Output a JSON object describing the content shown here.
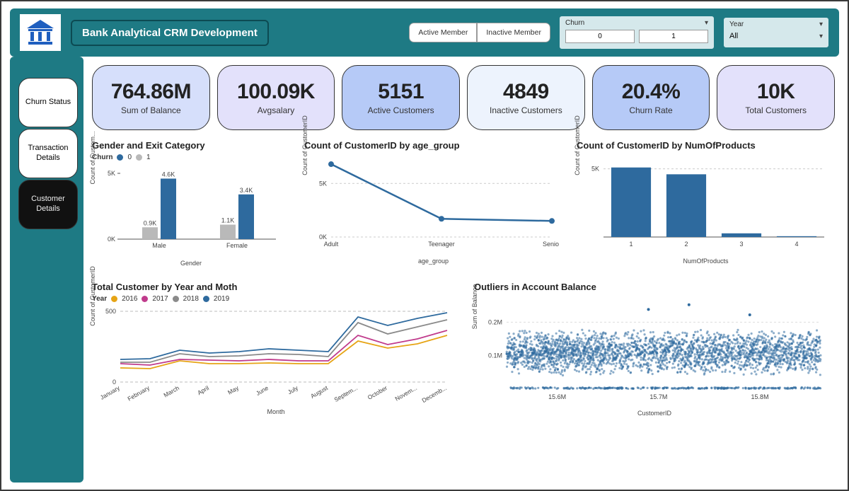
{
  "header": {
    "title": "Bank Analytical CRM Development",
    "member_buttons": [
      "Active Member",
      "Inactive Member"
    ],
    "churn_slicer": {
      "label": "Churn",
      "options": [
        "0",
        "1"
      ]
    },
    "year_slicer": {
      "label": "Year",
      "value": "All"
    }
  },
  "nav": {
    "items": [
      {
        "label": "Churn Status",
        "active": false
      },
      {
        "label": "Transaction Details",
        "active": false
      },
      {
        "label": "Customer Details",
        "active": true
      }
    ]
  },
  "kpis": [
    {
      "value": "764.86M",
      "label": "Sum of Balance",
      "bg": "bg-lav"
    },
    {
      "value": "100.09K",
      "label": "Avgsalary",
      "bg": "bg-lav2"
    },
    {
      "value": "5151",
      "label": "Active Customers",
      "bg": "bg-blue"
    },
    {
      "value": "4849",
      "label": "Inactive Customers",
      "bg": "bg-pale"
    },
    {
      "value": "20.4%",
      "label": "Churn Rate",
      "bg": "bg-blue"
    },
    {
      "value": "10K",
      "label": "Total Customers",
      "bg": "bg-lav2"
    }
  ],
  "chart_data": [
    {
      "id": "gender_exit",
      "title": "Gender and Exit Category",
      "type": "bar",
      "legend_label": "Churn",
      "categories": [
        "Male",
        "Female"
      ],
      "series": [
        {
          "name": "1",
          "values": [
            0.9,
            1.1
          ],
          "labels": [
            "0.9K",
            "1.1K"
          ],
          "color": "#b9b9b9"
        },
        {
          "name": "0",
          "values": [
            4.6,
            3.4
          ],
          "labels": [
            "4.6K",
            "3.4K"
          ],
          "color": "#2e6a9e"
        }
      ],
      "xlabel": "Gender",
      "ylabel": "Count of Custom...",
      "ylim": [
        0,
        5
      ],
      "yticks": [
        "0K",
        "5K"
      ]
    },
    {
      "id": "age_group",
      "title": "Count of CustomerID by age_group",
      "type": "line",
      "categories": [
        "Adult",
        "Teenager",
        "Senior"
      ],
      "values": [
        6800,
        1700,
        1500
      ],
      "xlabel": "age_group",
      "ylabel": "Count of CustomerID",
      "ylim": [
        0,
        7000
      ],
      "yticks": [
        "0K",
        "5K"
      ],
      "color": "#2e6a9e"
    },
    {
      "id": "num_products",
      "title": "Count of CustomerID by NumOfProducts",
      "type": "bar",
      "categories": [
        "1",
        "2",
        "3",
        "4"
      ],
      "values": [
        5100,
        4600,
        270,
        60
      ],
      "xlabel": "NumOfProducts",
      "ylabel": "Count of CustomerID",
      "ylim": [
        0,
        5500
      ],
      "yticks": [
        "5K"
      ],
      "color": "#2e6a9e"
    },
    {
      "id": "year_month",
      "title": "Total Customer by Year and Moth",
      "type": "line",
      "legend_label": "Year",
      "categories": [
        "January",
        "February",
        "March",
        "April",
        "May",
        "June",
        "July",
        "August",
        "Septem...",
        "October",
        "Novem...",
        "Decemb..."
      ],
      "series": [
        {
          "name": "2016",
          "color": "#e6a415",
          "values": [
            100,
            95,
            150,
            130,
            130,
            135,
            130,
            130,
            290,
            240,
            270,
            330
          ]
        },
        {
          "name": "2017",
          "color": "#c03b8c",
          "values": [
            130,
            120,
            160,
            155,
            150,
            160,
            150,
            150,
            330,
            265,
            305,
            365
          ]
        },
        {
          "name": "2018",
          "color": "#8a8a8a",
          "values": [
            140,
            140,
            200,
            180,
            185,
            200,
            195,
            180,
            420,
            340,
            390,
            440
          ]
        },
        {
          "name": "2019",
          "color": "#2e6a9e",
          "values": [
            160,
            165,
            225,
            205,
            215,
            235,
            225,
            215,
            460,
            400,
            450,
            490
          ]
        }
      ],
      "xlabel": "Month",
      "ylabel": "Count of CustomerID",
      "ylim": [
        0,
        500
      ],
      "yticks": [
        "0",
        "500"
      ]
    },
    {
      "id": "outliers",
      "title": "Outliers in Account Balance",
      "type": "scatter",
      "xlabel": "CustomerID",
      "ylabel": "Sum of Balance",
      "xlim": [
        15550000,
        15860000
      ],
      "ylim": [
        0,
        260000
      ],
      "xticks": [
        "15.6M",
        "15.7M",
        "15.8M"
      ],
      "yticks": [
        "0.1M",
        "0.2M"
      ],
      "note": "dense cloud approx 0.04M–0.18M plus band near 0 plus a few high outliers around 0.25M",
      "color": "#2e6a9e"
    }
  ]
}
